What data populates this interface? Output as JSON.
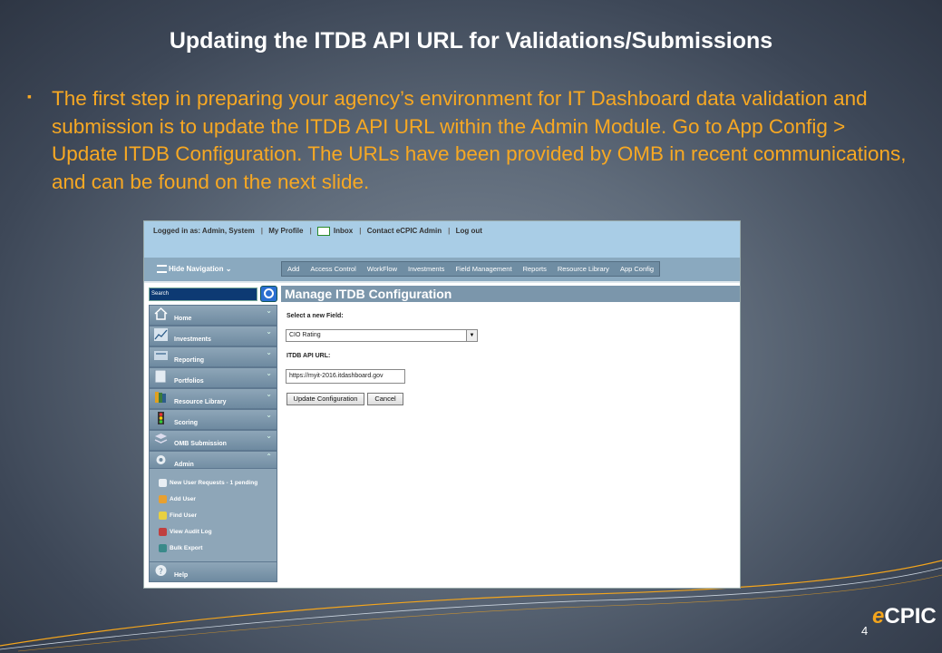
{
  "slide": {
    "title": "Updating the ITDB API URL for Validations/Submissions",
    "bullet_marker": "▪",
    "body": "The first step in preparing your agency’s environment for IT Dashboard data validation and submission is to update the ITDB API URL within the Admin Module. Go to App Config > Update ITDB Configuration. The URLs have been provided by OMB in recent communications, and can be found on the next slide.",
    "page_number": "4",
    "logo": {
      "prefix": "e",
      "name": "CPIC"
    },
    "colors": {
      "title": "#ffffff",
      "body": "#f7a823",
      "accent": "#f4a51c"
    }
  },
  "screenshot": {
    "topbar": {
      "logged_in": "Logged in as: Admin, System",
      "my_profile": "My Profile",
      "inbox": "Inbox",
      "contact": "Contact eCPIC Admin",
      "logout": "Log out"
    },
    "hide_navigation": "Hide Navigation",
    "menu": [
      "Add",
      "Access Control",
      "WorkFlow",
      "Investments",
      "Field Management",
      "Reports",
      "Resource Library",
      "App Config"
    ],
    "search_placeholder": "Search",
    "nav_items": [
      {
        "label": "Home",
        "icon": "home-icon"
      },
      {
        "label": "Investments",
        "icon": "investments-icon"
      },
      {
        "label": "Reporting",
        "icon": "reporting-icon"
      },
      {
        "label": "Portfolios",
        "icon": "portfolios-icon"
      },
      {
        "label": "Resource Library",
        "icon": "resource-library-icon"
      },
      {
        "label": "Scoring",
        "icon": "scoring-icon"
      },
      {
        "label": "OMB Submission",
        "icon": "omb-submission-icon"
      },
      {
        "label": "Admin",
        "icon": "admin-icon"
      }
    ],
    "admin_sub_items": [
      "New User Requests - 1 pending",
      "Add User",
      "Find User",
      "View Audit Log",
      "Bulk Export"
    ],
    "help": "Help",
    "main": {
      "heading": "Manage ITDB Configuration",
      "select_label": "Select a new Field:",
      "select_value": "CIO Rating",
      "api_label": "ITDB API URL:",
      "api_value": "https://myit-2016.itdashboard.gov",
      "update_button": "Update Configuration",
      "cancel_button": "Cancel"
    }
  }
}
